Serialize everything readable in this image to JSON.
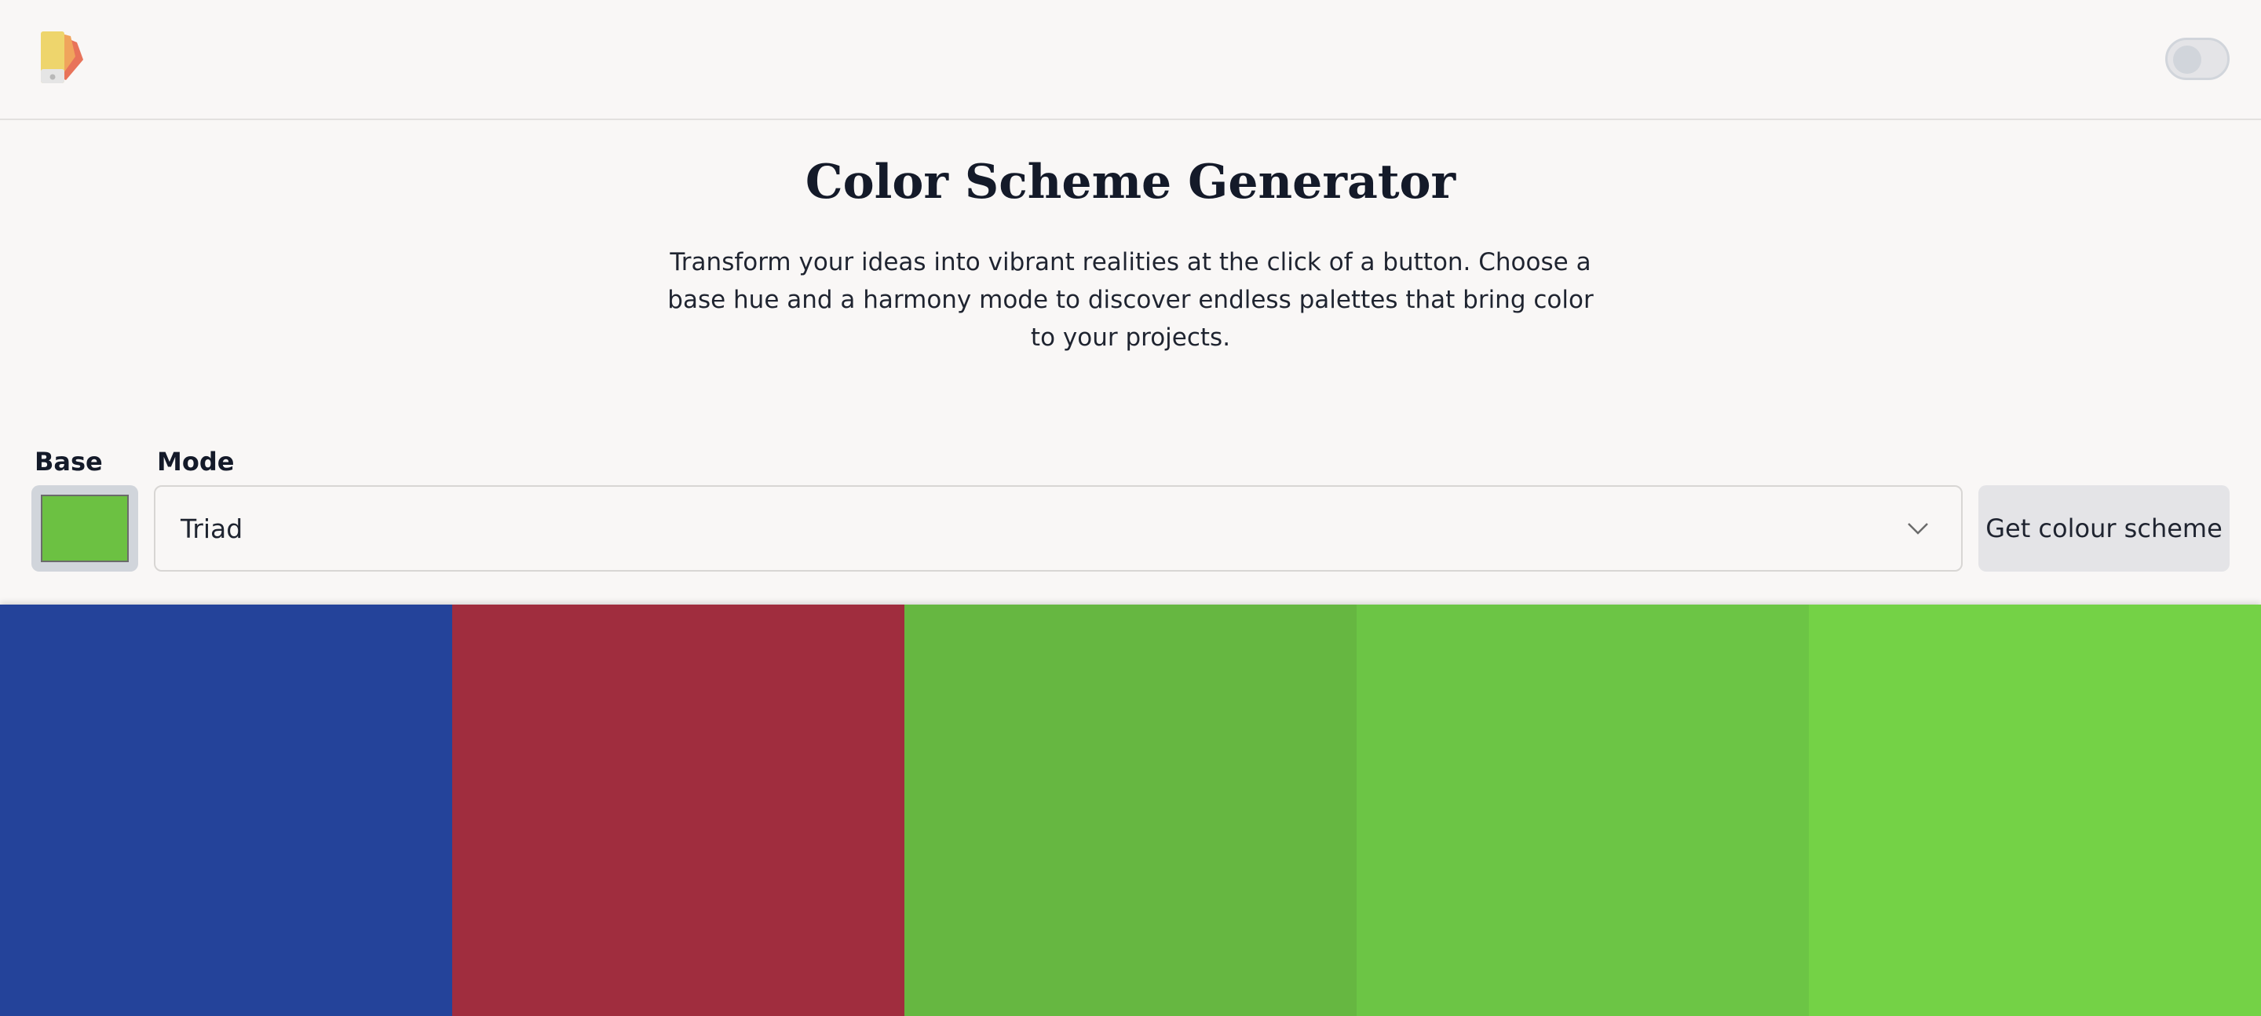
{
  "header": {
    "logo_icon": "palette-swatch-icon",
    "theme_toggle": {
      "state": "off",
      "icon": "toggle-switch-icon"
    }
  },
  "hero": {
    "title": "Color Scheme Generator",
    "description": "Transform your ideas into vibrant realities at the click of a button. Choose a base hue and a harmony mode to discover endless palettes that bring color to your projects."
  },
  "form": {
    "base_label": "Base",
    "base_color": "#6cc142",
    "mode_label": "Mode",
    "mode_value": "Triad",
    "mode_icon": "chevron-down-icon",
    "submit_label": "Get colour scheme"
  },
  "palette": {
    "colors": [
      "#24439a",
      "#a02d3e",
      "#66b741",
      "#6cc545",
      "#74d246"
    ]
  }
}
